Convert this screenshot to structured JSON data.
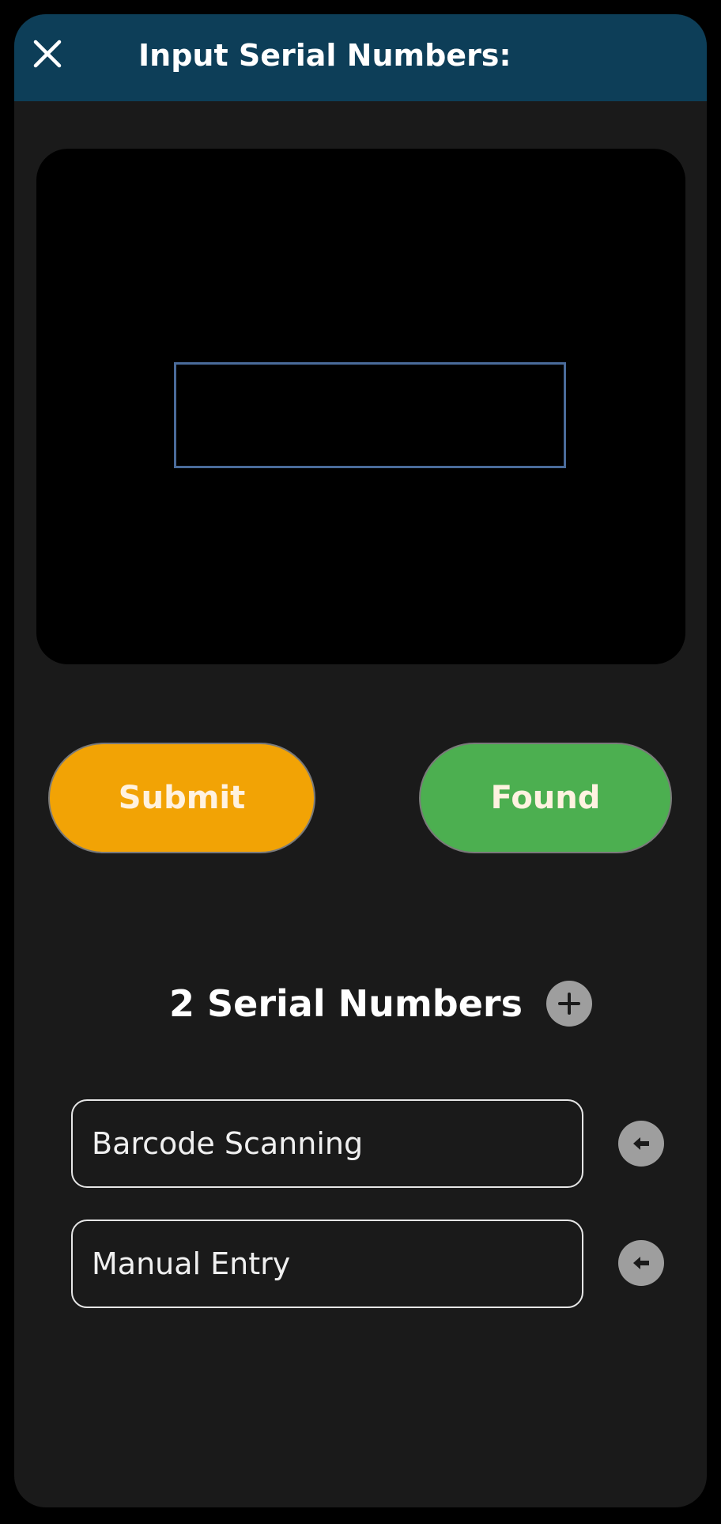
{
  "header": {
    "title": "Input Serial Numbers:",
    "close_icon": "close-icon",
    "background": "#0d3e58"
  },
  "camera": {
    "scan_frame_color": "#4a6b9a"
  },
  "actions": {
    "submit_label": "Submit",
    "submit_color": "#f2a305",
    "found_label": "Found",
    "found_color": "#4caf50"
  },
  "serials": {
    "count_label": "2 Serial Numbers",
    "add_icon": "plus-icon",
    "items": [
      {
        "value": "Barcode Scanning",
        "remove_icon": "arrow-left-icon"
      },
      {
        "value": "Manual Entry",
        "remove_icon": "arrow-left-icon"
      }
    ]
  }
}
